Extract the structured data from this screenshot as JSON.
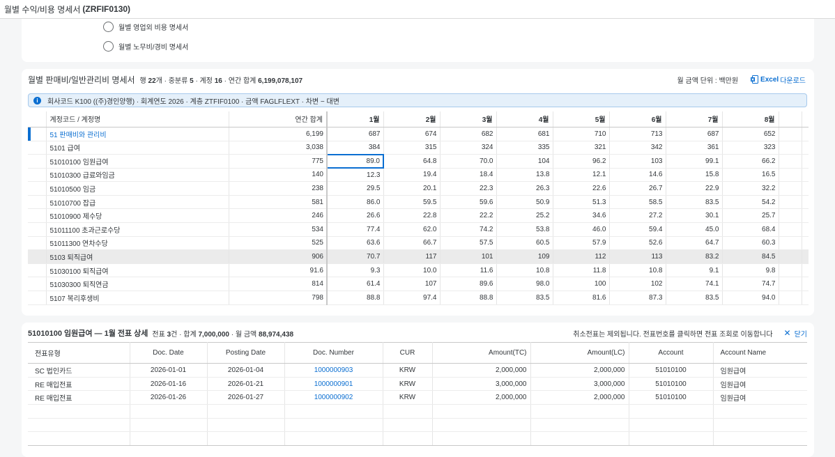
{
  "window": {
    "title": "월별 수익/비용 명세서",
    "code": "(ZRFIF0130)"
  },
  "options": [
    {
      "label": "월별 영업외 비용 명세서"
    },
    {
      "label": "월별 노무비/경비 명세서"
    }
  ],
  "main": {
    "title": "월별 판매비/일반관리비 명세서",
    "meta": {
      "rows_label": "행",
      "rows": "22",
      "rows_unit": "개 · 중분류",
      "mid": "5",
      "accounts_label": "· 계정",
      "accounts": "16",
      "total_label": "· 연간 합계",
      "total": "6,199,078,107"
    },
    "unit_label": "월 금액 단위 : 백만원",
    "excel_bold": "Excel",
    "excel_rest": "다운로드",
    "info": "회사코드 K100 ((주)경인양행) · 회계연도 2026 · 계층 ZTFIF0100 · 금액 FAGLFLEXT · 차변 − 대변",
    "columns": [
      "계정코드 / 계정명",
      "연간 합계",
      "1월",
      "2월",
      "3월",
      "4월",
      "5월",
      "6월",
      "7월",
      "8월"
    ],
    "rows": [
      {
        "name": "51 판매비와 관리비",
        "annual": "6,199",
        "m": [
          "687",
          "674",
          "682",
          "681",
          "710",
          "713",
          "687",
          "652"
        ]
      },
      {
        "name": "5101 급여",
        "annual": "3,038",
        "m": [
          "384",
          "315",
          "324",
          "335",
          "321",
          "342",
          "361",
          "323"
        ]
      },
      {
        "name": "51010100 임원급여",
        "annual": "775",
        "m": [
          "89.0",
          "64.8",
          "70.0",
          "104",
          "96.2",
          "103",
          "99.1",
          "66.2"
        ]
      },
      {
        "name": "51010300 급료와임금",
        "annual": "140",
        "m": [
          "12.3",
          "19.4",
          "18.4",
          "13.8",
          "12.1",
          "14.6",
          "15.8",
          "16.5"
        ]
      },
      {
        "name": "51010500 임금",
        "annual": "238",
        "m": [
          "29.5",
          "20.1",
          "22.3",
          "26.3",
          "22.6",
          "26.7",
          "22.9",
          "32.2"
        ]
      },
      {
        "name": "51010700 잡급",
        "annual": "581",
        "m": [
          "86.0",
          "59.5",
          "59.6",
          "50.9",
          "51.3",
          "58.5",
          "83.5",
          "54.2"
        ]
      },
      {
        "name": "51010900 제수당",
        "annual": "246",
        "m": [
          "26.6",
          "22.8",
          "22.2",
          "25.2",
          "34.6",
          "27.2",
          "30.1",
          "25.7"
        ]
      },
      {
        "name": "51011100 초과근로수당",
        "annual": "534",
        "m": [
          "77.4",
          "62.0",
          "74.2",
          "53.8",
          "46.0",
          "59.4",
          "45.0",
          "68.4"
        ]
      },
      {
        "name": "51011300 연차수당",
        "annual": "525",
        "m": [
          "63.6",
          "66.7",
          "57.5",
          "60.5",
          "57.9",
          "52.6",
          "64.7",
          "60.3"
        ]
      },
      {
        "name": "5103 퇴직급여",
        "annual": "906",
        "m": [
          "70.7",
          "117",
          "101",
          "109",
          "112",
          "113",
          "83.2",
          "84.5"
        ]
      },
      {
        "name": "51030100 퇴직급여",
        "annual": "91.6",
        "m": [
          "9.3",
          "10.0",
          "11.6",
          "10.8",
          "11.8",
          "10.8",
          "9.1",
          "9.8"
        ]
      },
      {
        "name": "51030300 퇴직연금",
        "annual": "814",
        "m": [
          "61.4",
          "107",
          "89.6",
          "98.0",
          "100",
          "102",
          "74.1",
          "74.7"
        ]
      },
      {
        "name": "5107 복리후생비",
        "annual": "798",
        "m": [
          "88.8",
          "97.4",
          "88.8",
          "83.5",
          "81.6",
          "87.3",
          "83.5",
          "94.0"
        ]
      }
    ]
  },
  "detail": {
    "title": "51010100 임원급여 — 1월 전표 상세",
    "sub": {
      "doc_label": "전표",
      "count": "3",
      "count_unit": "건 · 합계",
      "sum": "7,000,000",
      "month_label": "· 월 금액",
      "month_amount": "88,974,438"
    },
    "note": "취소전표는 제외됩니다. 전표번호를 클릭하면 전표 조회로 이동합니다",
    "close_label": "닫기",
    "columns": [
      "전표유형",
      "Doc. Date",
      "Posting Date",
      "Doc. Number",
      "CUR",
      "Amount(TC)",
      "Amount(LC)",
      "Account",
      "Account Name"
    ],
    "rows": [
      {
        "type": "SC 법인카드",
        "doc_date": "2026-01-01",
        "post_date": "2026-01-04",
        "doc_no": "1000000903",
        "cur": "KRW",
        "tc": "2,000,000",
        "lc": "2,000,000",
        "acct": "51010100",
        "acct_name": "임원급여"
      },
      {
        "type": "RE 매입전표",
        "doc_date": "2026-01-16",
        "post_date": "2026-01-21",
        "doc_no": "1000000901",
        "cur": "KRW",
        "tc": "3,000,000",
        "lc": "3,000,000",
        "acct": "51010100",
        "acct_name": "임원급여"
      },
      {
        "type": "RE 매입전표",
        "doc_date": "2026-01-26",
        "post_date": "2026-01-27",
        "doc_no": "1000000902",
        "cur": "KRW",
        "tc": "2,000,000",
        "lc": "2,000,000",
        "acct": "51010100",
        "acct_name": "임원급여"
      }
    ]
  }
}
